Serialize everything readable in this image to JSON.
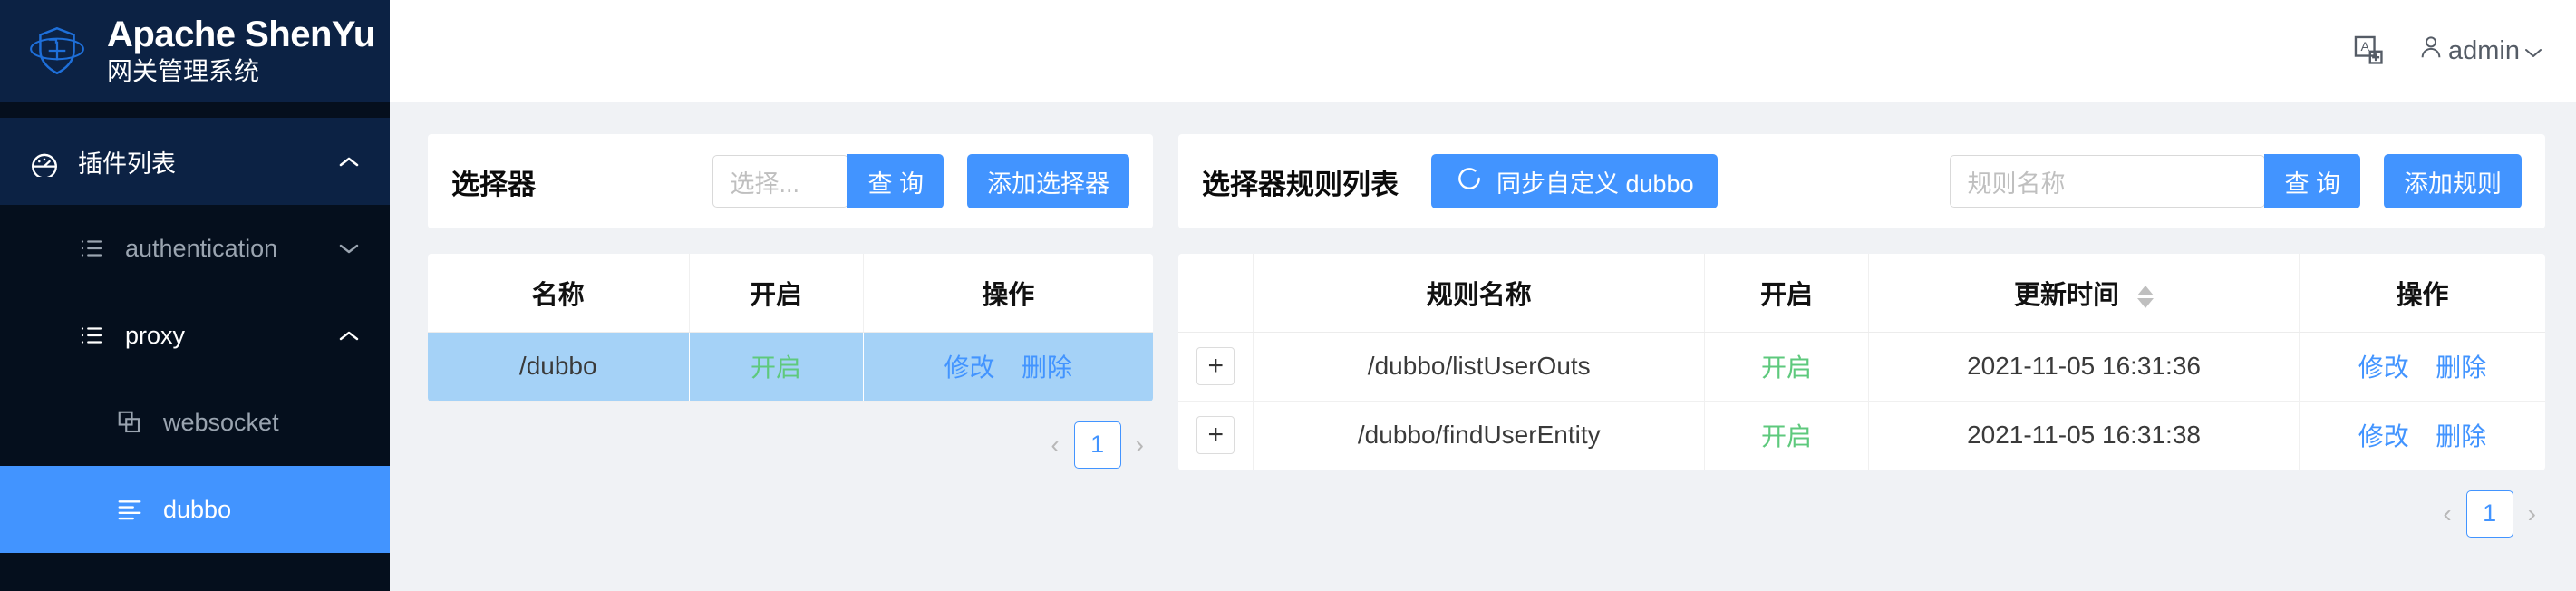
{
  "brand": {
    "title": "Apache ShenYu",
    "subtitle": "网关管理系统",
    "logo_icon": "shield-plus-logo"
  },
  "topbar": {
    "lang_icon": "translate-icon",
    "user_icon": "user-icon",
    "user_name": "admin",
    "user_caret_icon": "chevron-down-icon"
  },
  "sidebar": {
    "group": {
      "label": "插件列表",
      "icon": "dashboard-icon",
      "caret_icon": "chevron-up-icon",
      "expanded": true
    },
    "items": [
      {
        "label": "authentication",
        "icon": "list-icon",
        "caret_icon": "chevron-down-icon",
        "level": 2,
        "state": "collapsed"
      },
      {
        "label": "proxy",
        "icon": "list-icon",
        "caret_icon": "chevron-up-icon",
        "level": 2,
        "state": "expanded"
      },
      {
        "label": "websocket",
        "icon": "copy-icon",
        "level": 3,
        "state": "normal"
      },
      {
        "label": "dubbo",
        "icon": "align-left-icon",
        "level": 3,
        "state": "active"
      }
    ]
  },
  "selector_panel": {
    "title": "选择器",
    "search_placeholder": "选择...",
    "search_value": "",
    "query_label": "查 询",
    "add_label": "添加选择器",
    "columns": [
      "名称",
      "开启",
      "操作"
    ],
    "rows": [
      {
        "name": "/dubbo",
        "status": "开启",
        "edit": "修改",
        "delete": "删除",
        "selected": true
      }
    ],
    "pagination": {
      "prev_icon": "chevron-left-icon",
      "page": "1",
      "next_icon": "chevron-right-icon"
    }
  },
  "rule_panel": {
    "title": "选择器规则列表",
    "sync_label": "同步自定义 dubbo",
    "sync_icon": "refresh-icon",
    "search_placeholder": "规则名称",
    "search_value": "",
    "query_label": "查 询",
    "add_label": "添加规则",
    "columns": [
      "",
      "规则名称",
      "开启",
      "更新时间",
      "操作"
    ],
    "sort_column": "更新时间",
    "sort_icon": "sort-updown-icon",
    "expand_icon": "plus-icon",
    "rows": [
      {
        "expand": "+",
        "name": "/dubbo/listUserOuts",
        "status": "开启",
        "updated": "2021-11-05 16:31:36",
        "edit": "修改",
        "delete": "删除"
      },
      {
        "expand": "+",
        "name": "/dubbo/findUserEntity",
        "status": "开启",
        "updated": "2021-11-05 16:31:38",
        "edit": "修改",
        "delete": "删除"
      }
    ],
    "pagination": {
      "prev_icon": "chevron-left-icon",
      "page": "1",
      "next_icon": "chevron-right-icon"
    }
  },
  "colors": {
    "brand_dark": "#0c2244",
    "sidebar_bg": "#050f1d",
    "accent": "#4294ff",
    "status_green": "#5ec97d",
    "row_selected": "#a5d2f7",
    "page_bg": "#f0f2f5"
  }
}
